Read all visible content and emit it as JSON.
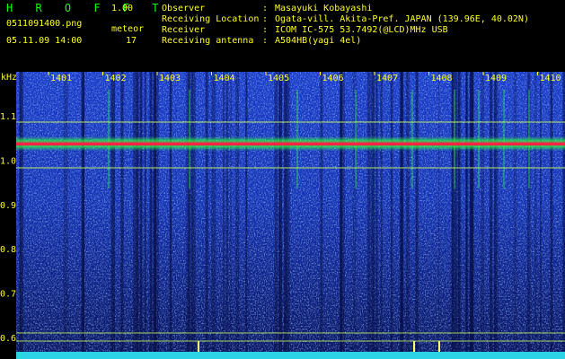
{
  "header": {
    "app_title": "H R O F F T",
    "version": "1.00",
    "file_name": "0511091400.png",
    "date_time": "05.11.09 14:00",
    "meteor_label": "meteor",
    "meteor_count": "17",
    "separator": ":",
    "observer_label": "Observer",
    "observer_value": "Masayuki Kobayashi",
    "location_label": "Receiving Location",
    "location_value": "Ogata-vill. Akita-Pref. JAPAN (139.96E, 40.02N)",
    "receiver_label": "Receiver",
    "receiver_value": "ICOM IC-575 53.7492(@LCD)MHz USB",
    "antenna_label": "Receiving antenna",
    "antenna_value": "A504HB(yagi 4el)"
  },
  "spectrogram": {
    "unit_label": "kHz",
    "time_ticks": [
      "1401",
      "1402",
      "1403",
      "1404",
      "1405",
      "1406",
      "1407",
      "1408",
      "1409",
      "1410"
    ],
    "freq_ticks": [
      "1.1",
      "1.0",
      "0.9",
      "0.8",
      "0.7",
      "0.6"
    ],
    "colors": {
      "background": "#0a1a8c",
      "noise_light": "#3a7bff",
      "noise_cyan": "#2ad4e6",
      "carrier": "#ff2244",
      "carrier_edge": "#30ff40",
      "guide_line": "#c8ff60",
      "labels": "#ffff22"
    }
  }
}
